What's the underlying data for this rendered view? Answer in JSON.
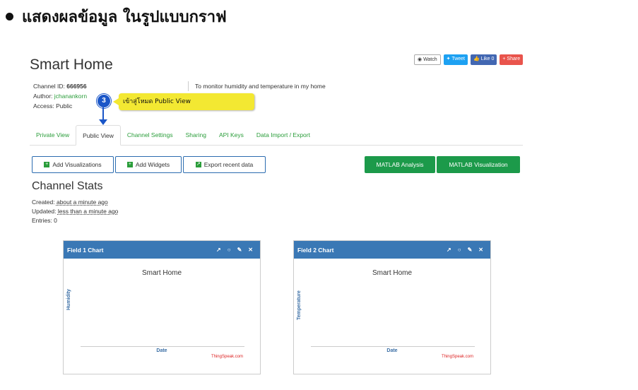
{
  "slide_title": "แสดงผลข้อมูล ในรูปแบบกราฟ",
  "share": {
    "watch": "Watch",
    "tweet": "Tweet",
    "like": "Like 0",
    "share": "Share"
  },
  "channel": {
    "title": "Smart Home",
    "id_label": "Channel ID: ",
    "id": "666956",
    "author_label": "Author: ",
    "author": "jchanankorn",
    "access": "Access: Public",
    "description": "To monitor humidity and temperature in my home"
  },
  "callout": {
    "number": "3",
    "text": "เข้าสู่โหมด Public View"
  },
  "tabs": [
    "Private View",
    "Public View",
    "Channel Settings",
    "Sharing",
    "API Keys",
    "Data Import / Export"
  ],
  "buttons": {
    "add_vis": "Add Visualizations",
    "add_widgets": "Add Widgets",
    "export": "Export recent data",
    "matlab_analysis": "MATLAB Analysis",
    "matlab_vis": "MATLAB Visualization"
  },
  "stats": {
    "title": "Channel Stats",
    "created_label": "Created: ",
    "created": "about a minute ago",
    "updated_label": "Updated: ",
    "updated": "less than a minute ago",
    "entries": "Entries: 0"
  },
  "charts": [
    {
      "header": "Field 1 Chart",
      "title": "Smart Home",
      "ylabel": "Humidity",
      "xlabel": "Date",
      "credit": "ThingSpeak.com"
    },
    {
      "header": "Field 2 Chart",
      "title": "Smart Home",
      "ylabel": "Temperature",
      "xlabel": "Date",
      "credit": "ThingSpeak.com"
    }
  ],
  "colors": {
    "accent_green": "#1c9a4a",
    "link_green": "#2a9d3a",
    "chart_header": "#3a78b5",
    "callout_yellow": "#f3e832",
    "callout_blue": "#1a56c8"
  }
}
